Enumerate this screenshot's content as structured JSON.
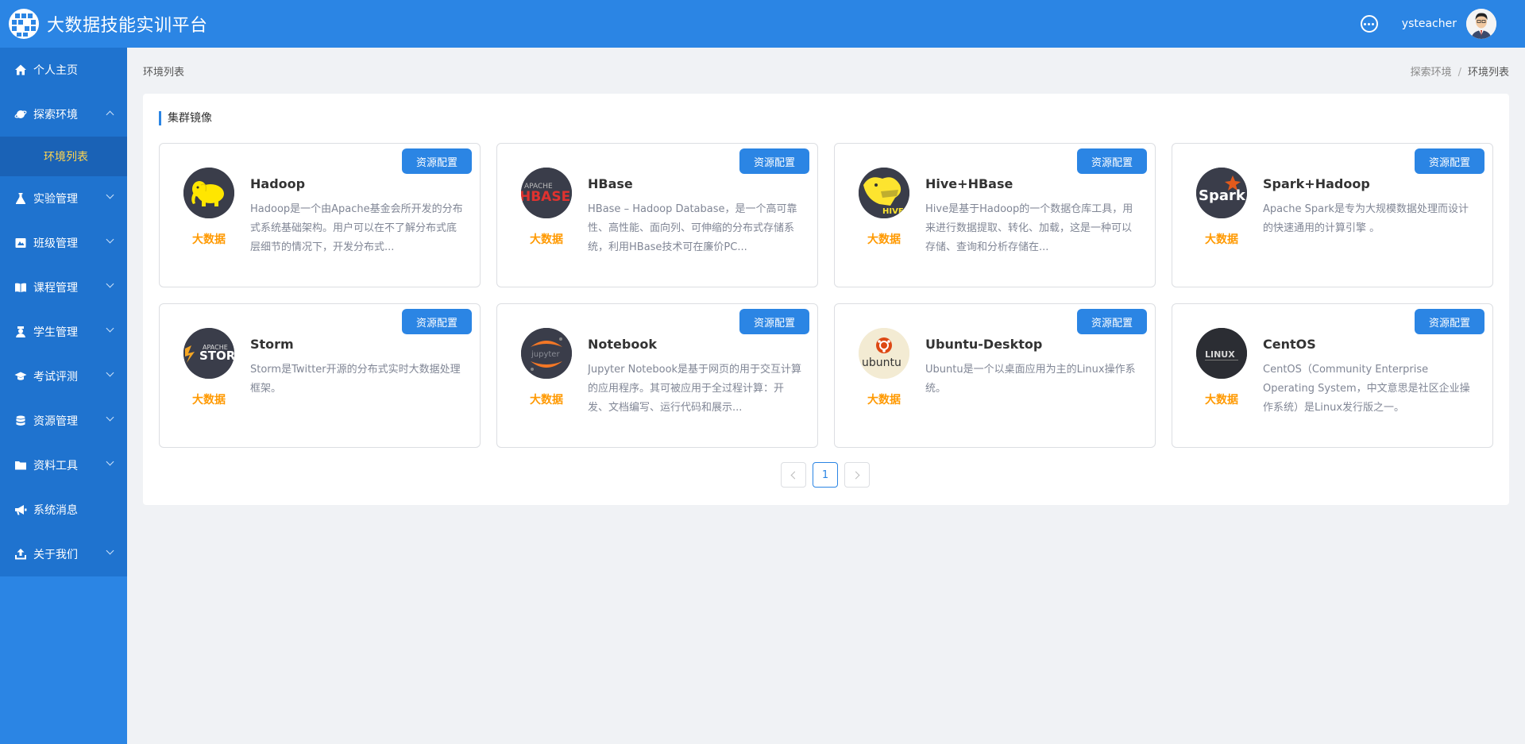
{
  "header": {
    "title": "大数据技能实训平台",
    "username": "ysteacher"
  },
  "sidebar": {
    "items": [
      {
        "label": "个人主页",
        "icon": "home-icon"
      },
      {
        "label": "探索环境",
        "icon": "explore-icon",
        "expanded": true,
        "children": [
          {
            "label": "环境列表",
            "active": true
          }
        ]
      },
      {
        "label": "实验管理",
        "icon": "flask-icon"
      },
      {
        "label": "班级管理",
        "icon": "class-icon"
      },
      {
        "label": "课程管理",
        "icon": "book-icon"
      },
      {
        "label": "学生管理",
        "icon": "student-icon"
      },
      {
        "label": "考试评测",
        "icon": "graduation-cap-icon"
      },
      {
        "label": "资源管理",
        "icon": "database-icon"
      },
      {
        "label": "资料工具",
        "icon": "folder-icon"
      },
      {
        "label": "系统消息",
        "icon": "megaphone-icon"
      },
      {
        "label": "关于我们",
        "icon": "upload-icon"
      }
    ]
  },
  "page": {
    "title": "环境列表",
    "breadcrumb": [
      "探索环境",
      "/",
      "环境列表"
    ]
  },
  "section": {
    "title": "集群镜像"
  },
  "config_label": "资源配置",
  "cards": [
    {
      "name": "Hadoop",
      "tag": "大数据",
      "desc": "Hadoop是一个由Apache基金会所开发的分布式系统基础架构。用户可以在不了解分布式底层细节的情况下，开发分布式...",
      "icon": "hadoop-elephant-icon"
    },
    {
      "name": "HBase",
      "tag": "大数据",
      "desc": "HBase – Hadoop Database，是一个高可靠性、高性能、面向列、可伸缩的分布式存储系统，利用HBase技术可在廉价PC...",
      "icon": "hbase-logo-icon",
      "logo_text": "HBASE",
      "logo_sub": "APACHE"
    },
    {
      "name": "Hive+HBase",
      "tag": "大数据",
      "desc": "Hive是基于Hadoop的一个数据仓库工具，用来进行数据提取、转化、加载，这是一种可以存储、查询和分析存储在...",
      "icon": "hive-bee-icon",
      "logo_text": "HIVE"
    },
    {
      "name": "Spark+Hadoop",
      "tag": "大数据",
      "desc": "Apache Spark是专为大规模数据处理而设计的快速通用的计算引擎 。",
      "icon": "spark-logo-icon",
      "logo_text": "Spark"
    },
    {
      "name": "Storm",
      "tag": "大数据",
      "desc": "Storm是Twitter开源的分布式实时大数据处理框架。",
      "icon": "storm-logo-icon",
      "logo_text": "STORM",
      "logo_sub": "APACHE"
    },
    {
      "name": "Notebook",
      "tag": "大数据",
      "desc": "Jupyter Notebook是基于网页的用于交互计算的应用程序。其可被应用于全过程计算：开发、文档编写、运行代码和展示...",
      "icon": "jupyter-logo-icon",
      "logo_text": "jupyter"
    },
    {
      "name": "Ubuntu-Desktop",
      "tag": "大数据",
      "desc": "Ubuntu是一个以桌面应用为主的Linux操作系统。",
      "icon": "ubuntu-logo-icon",
      "logo_text": "ubuntu"
    },
    {
      "name": "CentOS",
      "tag": "大数据",
      "desc": "CentOS（Community Enterprise Operating System，中文意思是社区企业操作系统）是Linux发行版之一。",
      "icon": "linux-logo-icon",
      "logo_text": "LINUX"
    }
  ],
  "pagination": {
    "current": "1"
  },
  "colors": {
    "primary": "#2b85e4",
    "tag": "#ff9900",
    "sub_active": "#ffd54f"
  }
}
